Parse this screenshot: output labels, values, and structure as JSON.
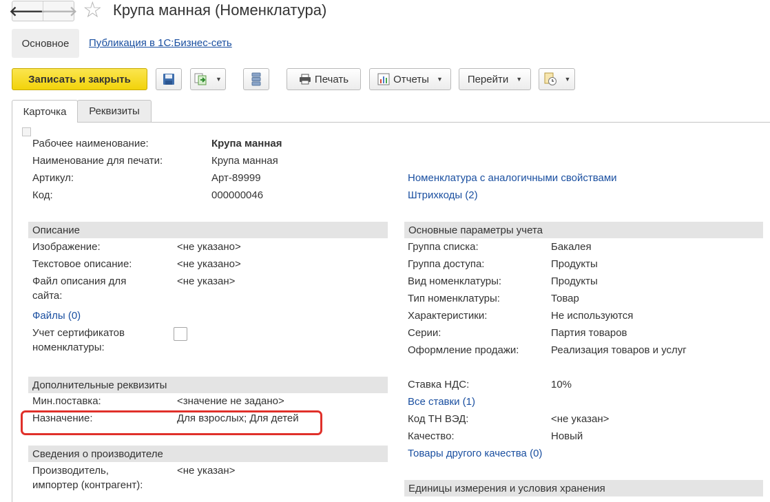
{
  "window": {
    "title": "Крупа манная (Номенклатура)"
  },
  "nav": {
    "back_icon": "arrow-left",
    "forward_icon": "arrow-right",
    "favorite_icon": "star-outline"
  },
  "sections": {
    "main_label": "Основное",
    "publication_link": "Публикация в 1С:Бизнес-сеть"
  },
  "toolbar": {
    "save_close_label": "Записать и закрыть",
    "print_label": "Печать",
    "reports_label": "Отчеты",
    "goto_label": "Перейти"
  },
  "tabs": [
    {
      "label": "Карточка",
      "active": true
    },
    {
      "label": "Реквизиты",
      "active": false
    }
  ],
  "header_fields": {
    "work_name_label": "Рабочее наименование:",
    "work_name_value": "Крупа манная",
    "print_name_label": "Наименование для печати:",
    "print_name_value": "Крупа манная",
    "article_label": "Артикул:",
    "article_value": "Арт-89999",
    "code_label": "Код:",
    "code_value": "000000046",
    "similar_link": "Номенклатура с аналогичными свойствами",
    "barcodes_link": "Штрихкоды (2)"
  },
  "description": {
    "heading": "Описание",
    "image_label": "Изображение:",
    "image_value": "<не указано>",
    "text_label": "Текстовое описание:",
    "text_value": "<не указано>",
    "site_file_label_1": "Файл описания для",
    "site_file_label_2": "сайта:",
    "site_file_value": "<не указан>",
    "files_link": "Файлы (0)",
    "certificates_label_1": "Учет сертификатов",
    "certificates_label_2": "номенклатуры:"
  },
  "additional": {
    "heading": "Дополнительные реквизиты",
    "min_supply_label": "Мин.поставка:",
    "min_supply_value": "<значение не задано>",
    "purpose_label": "Назначение:",
    "purpose_value": "Для взрослых; Для детей"
  },
  "manufacturer": {
    "heading": "Сведения о производителе",
    "producer_label_1": "Производитель,",
    "producer_label_2": "импортер (контрагент):",
    "producer_value": "<не указан>"
  },
  "accounting": {
    "heading": "Основные параметры учета",
    "rows": [
      {
        "label": "Группа списка:",
        "value": "Бакалея"
      },
      {
        "label": "Группа доступа:",
        "value": "Продукты"
      },
      {
        "label": "Вид номенклатуры:",
        "value": "Продукты"
      },
      {
        "label": "Тип номенклатуры:",
        "value": "Товар"
      },
      {
        "label": "Характеристики:",
        "value": "Не используются"
      },
      {
        "label": "Серии:",
        "value": "Партия товаров"
      },
      {
        "label": "Оформление продажи:",
        "value": "Реализация товаров и услуг"
      }
    ],
    "vat_label": "Ставка НДС:",
    "vat_value": "10%",
    "all_rates_link": "Все ставки (1)",
    "tnved_label": "Код ТН ВЭД:",
    "tnved_value": "<не указан>",
    "quality_label": "Качество:",
    "quality_value": "Новый",
    "other_quality_link": "Товары другого качества (0)"
  },
  "units": {
    "heading": "Единицы измерения и условия хранения"
  },
  "colors": {
    "primary_button": "#f2d30a",
    "link": "#1a4fa0",
    "group_header": "#e4e4e4",
    "highlight": "#e0302a"
  }
}
